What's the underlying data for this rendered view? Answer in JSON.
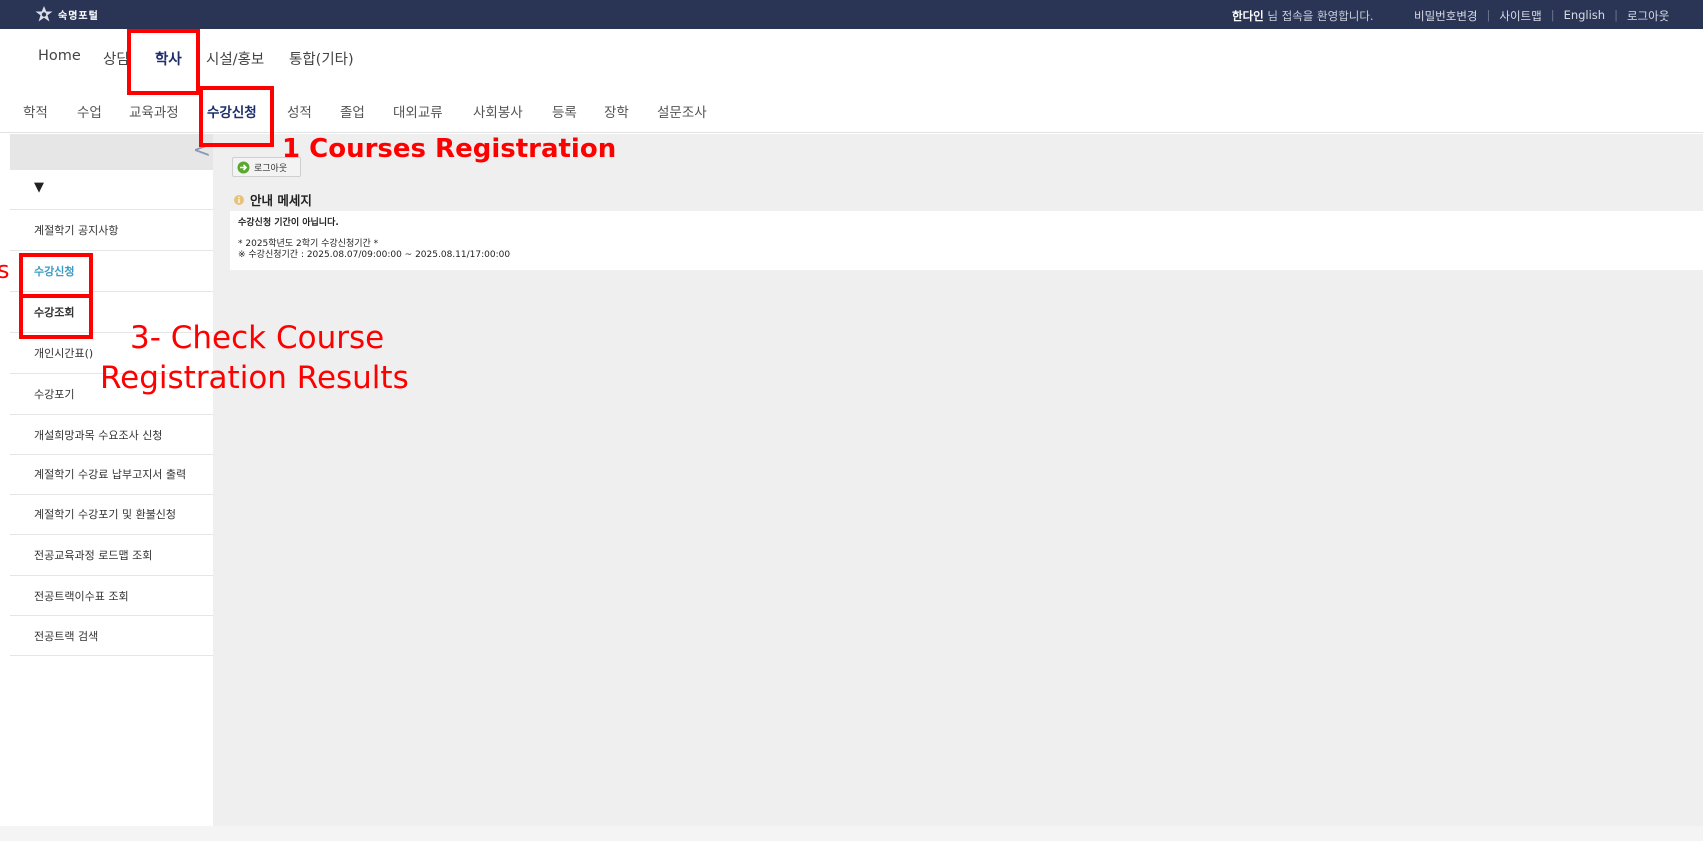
{
  "topbar": {
    "logo_text": "숙명포털",
    "logo_icon": "star-emblem-icon",
    "welcome_name": "한다인",
    "welcome_suffix": "님 접속을 환영합니다.",
    "links": [
      "비밀번호변경",
      "사이트맵",
      "English",
      "로그아웃"
    ]
  },
  "main_menu": {
    "items": [
      "Home",
      "상담",
      "학사",
      "시설/홍보",
      "통합(기타)"
    ],
    "active": "학사"
  },
  "sub_menu": {
    "items": [
      "학적",
      "수업",
      "교육과정",
      "수강신청",
      "성적",
      "졸업",
      "대외교류",
      "사회봉사",
      "등록",
      "장학",
      "설문조사"
    ],
    "active": "수강신청"
  },
  "sidebar": {
    "collapse_icon": "chevron-left-icon",
    "toggle": "▼",
    "items": [
      "계절학기 공지사항",
      "수강신청",
      "수강조회",
      "개인시간표()",
      "수강포기",
      "개설희망과목 수요조사 신청",
      "계절학기 수강료 납부고지서 출력",
      "계절학기 수강포기 및 환불신청",
      "전공교육과정 로드맵 조회",
      "전공트랙이수표 조회",
      "전공트랙 검색"
    ]
  },
  "content": {
    "logout_button": "로그아웃",
    "message_title": "안내 메세지",
    "message_line1": "수강신청 기간이 아닙니다.",
    "message_line2": "* 2025학년도 2학기 수강신청기간 *",
    "message_line3": "※ 수강신청기간 : 2025.08.07/09:00:00 ~ 2025.08.11/17:00:00"
  },
  "annotations": {
    "color": "#ff0000",
    "label1": "1  Courses Registration",
    "label2_fragment": "s",
    "label3_line1": "3- Check Course",
    "label3_line2": "Registration Results"
  }
}
